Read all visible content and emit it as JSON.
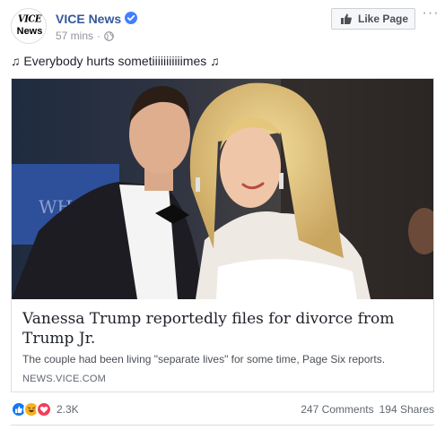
{
  "page": {
    "name": "VICE News",
    "avatar_text_top": "VICE",
    "avatar_text_bottom": "News",
    "timestamp": "57 mins",
    "separator": "·",
    "like_button_label": "Like Page",
    "more_label": "···",
    "verified_color": "#4080ff"
  },
  "post": {
    "message": "♫ Everybody hurts sometiiiiiiiiiiimes ♫"
  },
  "link": {
    "headline": "Vanessa Trump reportedly files for divorce from Trump Jr.",
    "summary": "The couple had been living \"separate lives\" for some time, Page Six reports.",
    "domain": "NEWS.VICE.COM"
  },
  "footer": {
    "reaction_count": "2.3K",
    "reactions": [
      "like-icon",
      "haha-icon",
      "love-icon"
    ],
    "comments": "247 Comments",
    "shares": "194 Shares"
  },
  "colors": {
    "link_blue": "#365899",
    "like_blue": "#1877f2",
    "haha_yellow": "#f7b125",
    "love_red": "#f33e58"
  }
}
